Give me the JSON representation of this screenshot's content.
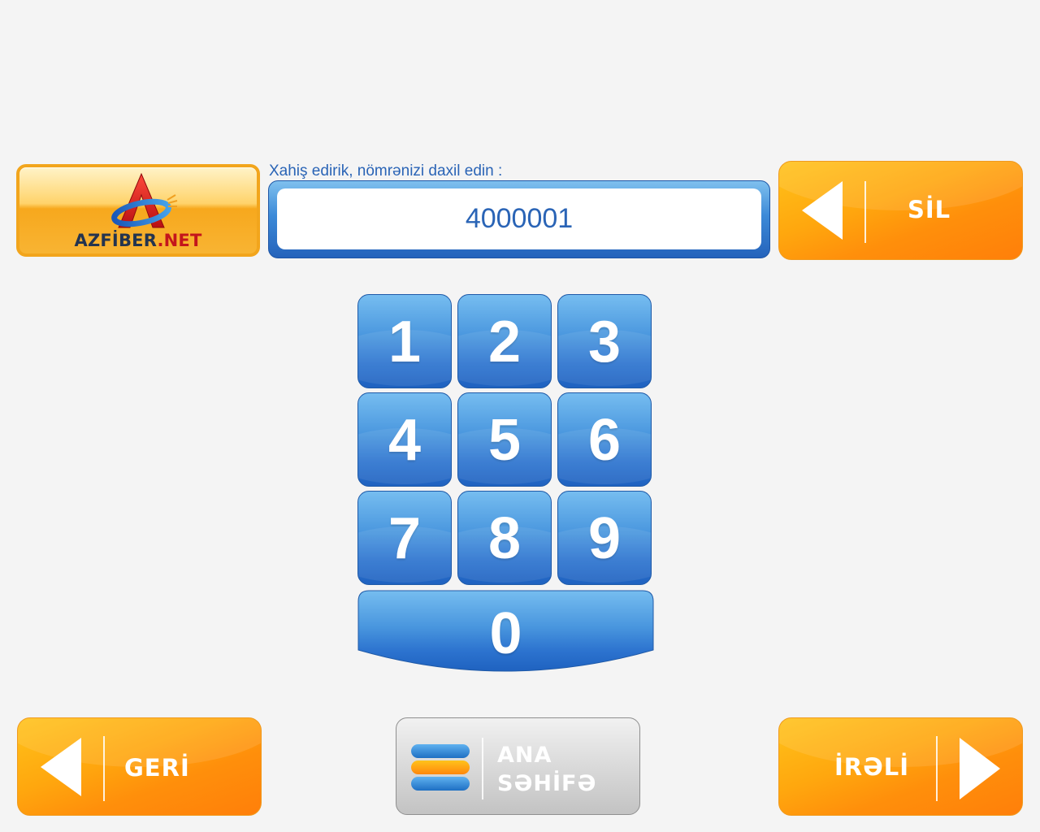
{
  "brand": {
    "logo_text_main": "AZFİBER",
    "logo_text_suffix": ".NET"
  },
  "prompt": {
    "label": "Xahiş edirik, nömrənizi daxil edin :"
  },
  "display": {
    "value": "4000001"
  },
  "buttons": {
    "delete_label": "SİL",
    "back_label": "GERİ",
    "home_label_line1": "ANA",
    "home_label_line2": "SƏHİFƏ",
    "forward_label": "İRƏLİ"
  },
  "keypad": {
    "keys": [
      "1",
      "2",
      "3",
      "4",
      "5",
      "6",
      "7",
      "8",
      "9"
    ],
    "zero": "0"
  },
  "colors": {
    "orange_button": "#ff9a10",
    "blue_key": "#3a86d8",
    "prompt_text": "#2a64b6",
    "background": "#f4f4f4"
  },
  "icons": {
    "delete": "arrow-left-icon",
    "back": "arrow-left-icon",
    "forward": "arrow-right-icon",
    "home": "home-stack-icon",
    "logo": "azfiber-logo-icon"
  }
}
